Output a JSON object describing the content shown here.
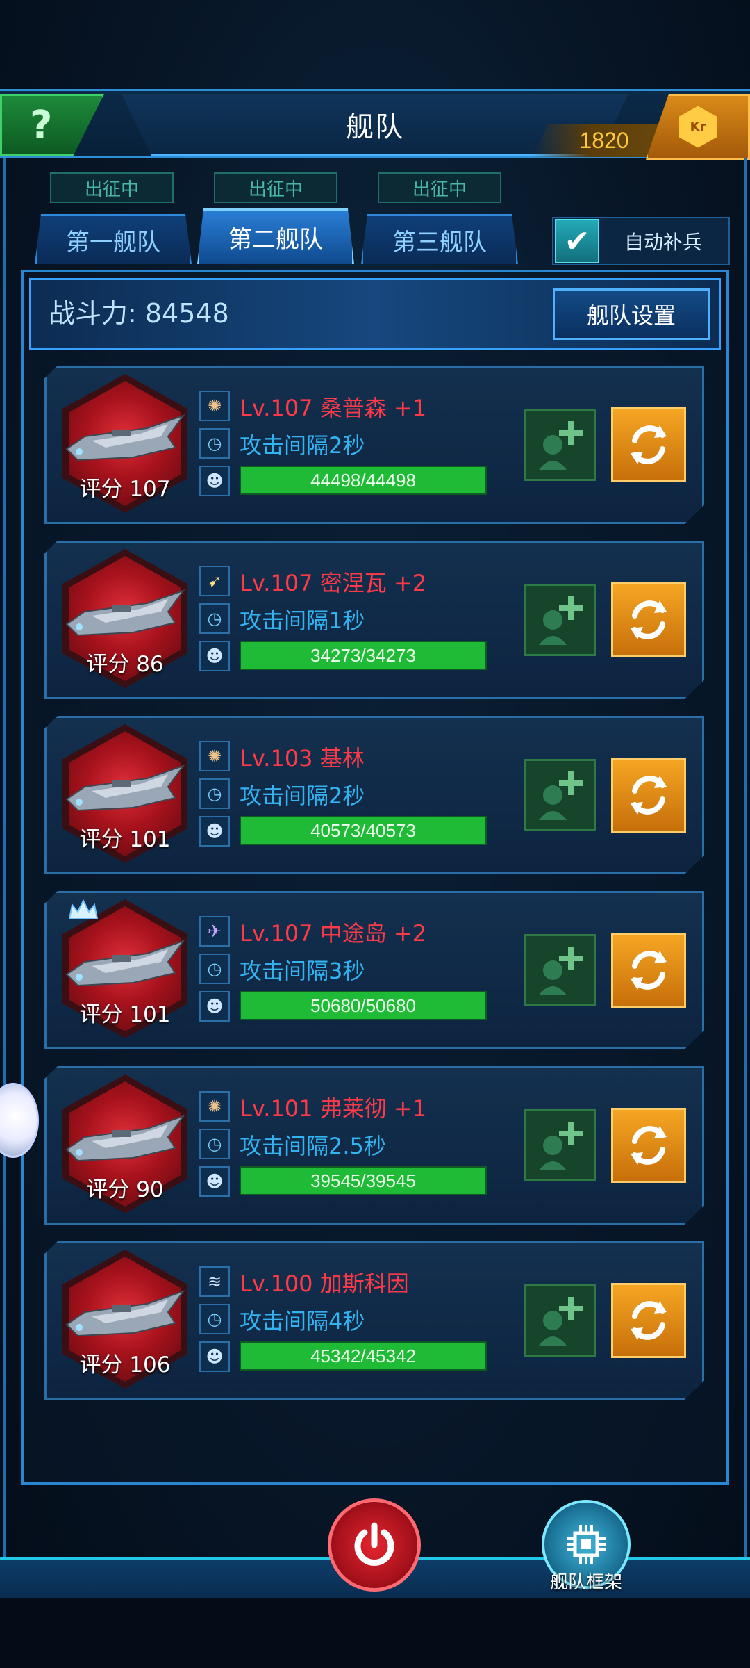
{
  "header": {
    "help_label": "?",
    "title": "舰队",
    "credits": "1820",
    "credit_icon_text": "Kr"
  },
  "tabs": [
    {
      "status": "出征中",
      "label": "第一舰队",
      "active": false
    },
    {
      "status": "出征中",
      "label": "第二舰队",
      "active": true
    },
    {
      "status": "出征中",
      "label": "第三舰队",
      "active": false
    }
  ],
  "auto_replenish": {
    "label": "自动补兵",
    "checked": true,
    "check_glyph": "✔"
  },
  "power": {
    "label": "战斗力: 84548"
  },
  "fleet_settings_label": "舰队设置",
  "ships": [
    {
      "score": "评分 107",
      "level_name": "Lv.107  桑普森 +1",
      "interval": "攻击间隔2秒",
      "hp": "44498/44498",
      "hp_fraction": 1.0,
      "type_icon": "missile-icon"
    },
    {
      "score": "评分 86",
      "level_name": "Lv.107  密涅瓦 +2",
      "interval": "攻击间隔1秒",
      "hp": "34273/34273",
      "hp_fraction": 1.0,
      "type_icon": "cannon-icon"
    },
    {
      "score": "评分 101",
      "level_name": "Lv.103  基林",
      "interval": "攻击间隔2秒",
      "hp": "40573/40573",
      "hp_fraction": 1.0,
      "type_icon": "missile-icon"
    },
    {
      "score": "评分 101",
      "level_name": "Lv.107  中途岛 +2",
      "interval": "攻击间隔3秒",
      "hp": "50680/50680",
      "hp_fraction": 1.0,
      "type_icon": "aircraft-icon"
    },
    {
      "score": "评分 90",
      "level_name": "Lv.101  弗莱彻 +1",
      "interval": "攻击间隔2.5秒",
      "hp": "39545/39545",
      "hp_fraction": 1.0,
      "type_icon": "missile-icon"
    },
    {
      "score": "评分 106",
      "level_name": "Lv.100  加斯科因",
      "interval": "攻击间隔4秒",
      "hp": "45342/45342",
      "hp_fraction": 1.0,
      "type_icon": "wing-icon"
    }
  ],
  "bottom": {
    "framework_label": "舰队框架"
  },
  "colors": {
    "ship_name": "#ff3a48",
    "interval": "#33b4f2",
    "hp_fill": "#1fbb36",
    "swap_button": "#f5a623",
    "credits": "#ffc83a"
  }
}
